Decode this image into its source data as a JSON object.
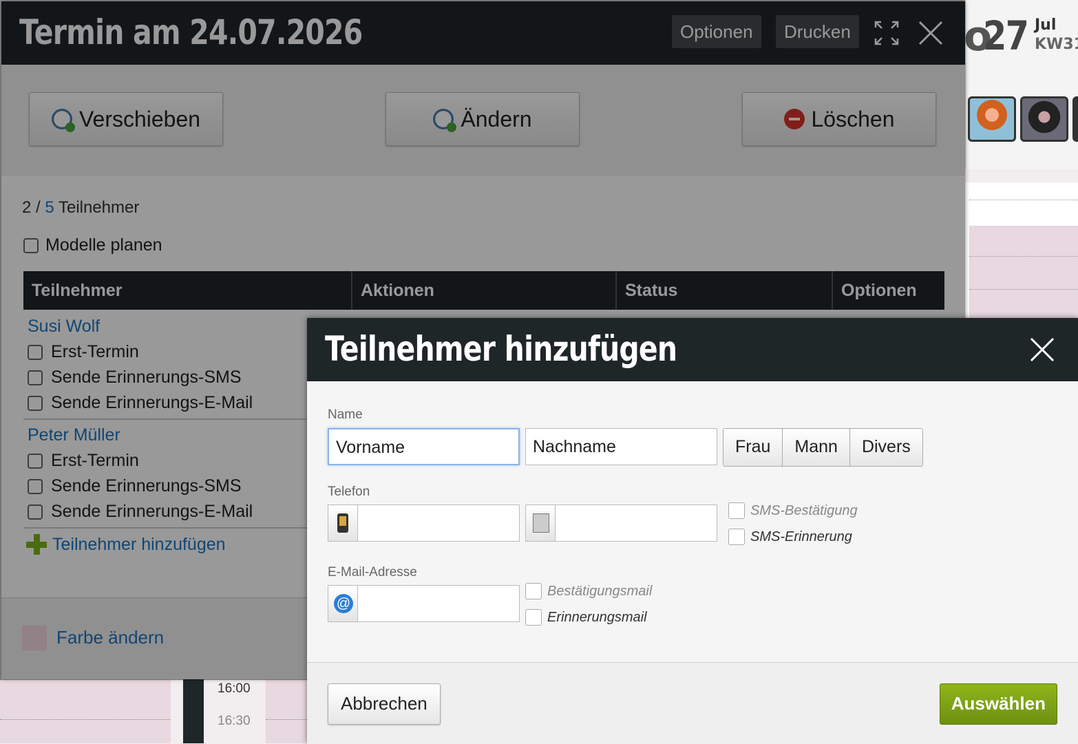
{
  "background": {
    "day_prefix": "o",
    "day_number": "27",
    "month": "Jul",
    "week": "KW31",
    "times": [
      "16:00",
      "16:30"
    ]
  },
  "termin": {
    "title": "Termin am 24.07.2026",
    "header_buttons": {
      "options": "Optionen",
      "print": "Drucken"
    },
    "actions": {
      "move": "Verschieben",
      "change": "Ändern",
      "delete": "Löschen"
    },
    "count": {
      "current": "2",
      "separator": " / ",
      "max": "5",
      "label": " Teilnehmer"
    },
    "plan_models": "Modelle planen",
    "table_headers": [
      "Teilnehmer",
      "Aktionen",
      "Status",
      "Optionen"
    ],
    "participants": [
      {
        "name": "Susi Wolf",
        "options": [
          "Erst-Termin",
          "Sende Erinnerungs-SMS",
          "Sende Erinnerungs-E-Mail"
        ]
      },
      {
        "name": "Peter Müller",
        "options": [
          "Erst-Termin",
          "Sende Erinnerungs-SMS",
          "Sende Erinnerungs-E-Mail"
        ]
      }
    ],
    "add_participant": "Teilnehmer hinzufügen",
    "change_color": "Farbe ändern",
    "color": "#f3d7e0"
  },
  "modal": {
    "title": "Teilnehmer hinzufügen",
    "name_label": "Name",
    "first_name": "Vorname",
    "last_name": "Nachname",
    "gender_options": [
      "Frau",
      "Mann",
      "Divers"
    ],
    "phone_label": "Telefon",
    "mobile_value": "",
    "landline_value": "",
    "sms_confirm": "SMS-Bestätigung",
    "sms_reminder": "SMS-Erinnerung",
    "email_label": "E-Mail-Adresse",
    "email_value": "",
    "confirm_mail": "Bestätigungsmail",
    "reminder_mail": "Erinnerungsmail",
    "cancel": "Abbrechen",
    "select": "Auswählen",
    "accent": "#7a9e14"
  }
}
